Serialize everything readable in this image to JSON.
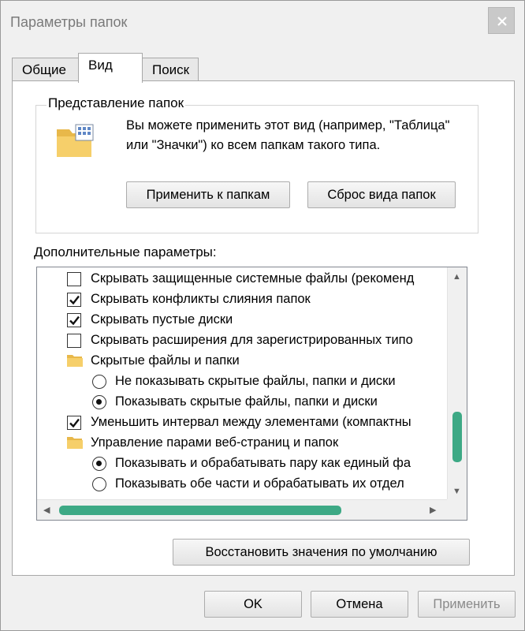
{
  "window": {
    "title": "Параметры папок"
  },
  "tabs": [
    {
      "label": "Общие"
    },
    {
      "label": "Вид"
    },
    {
      "label": "Поиск"
    }
  ],
  "folder_views": {
    "title": "Представление папок",
    "description": "Вы можете применить этот вид (например, \"Таблица\" или \"Значки\") ко всем папкам такого типа.",
    "apply_button": "Применить к папкам",
    "reset_button": "Сброс вида папок"
  },
  "advanced": {
    "label": "Дополнительные параметры:",
    "items": [
      {
        "type": "checkbox",
        "checked": false,
        "label": "Скрывать защищенные системные файлы (рекоменд"
      },
      {
        "type": "checkbox",
        "checked": true,
        "label": "Скрывать конфликты слияния папок"
      },
      {
        "type": "checkbox",
        "checked": true,
        "label": "Скрывать пустые диски"
      },
      {
        "type": "checkbox",
        "checked": false,
        "label": "Скрывать расширения для зарегистрированных типо"
      },
      {
        "type": "folder",
        "label": "Скрытые файлы и папки"
      },
      {
        "type": "radio",
        "checked": false,
        "label": "Не показывать скрытые файлы, папки и диски"
      },
      {
        "type": "radio",
        "checked": true,
        "label": "Показывать скрытые файлы, папки и диски"
      },
      {
        "type": "checkbox",
        "checked": true,
        "label": "Уменьшить интервал между элементами (компактны"
      },
      {
        "type": "folder",
        "label": "Управление парами веб-страниц и папок"
      },
      {
        "type": "radio",
        "checked": true,
        "label": "Показывать и обрабатывать пару как единый фа"
      },
      {
        "type": "radio",
        "checked": false,
        "label": "Показывать обе части и обрабатывать их отдел"
      }
    ],
    "restore_button": "Восстановить значения по умолчанию"
  },
  "footer": {
    "ok": "OK",
    "cancel": "Отмена",
    "apply": "Применить"
  },
  "colors": {
    "scroll_thumb": "#3da985",
    "window_bg": "#f0f0f0",
    "disabled_text": "#8a8a8a"
  },
  "icons": {
    "close": "close-icon",
    "folder_view": "folder-view-icon",
    "folder": "folder-icon",
    "checkmark": "checkmark-icon",
    "radio_dot": "radio-dot-icon"
  }
}
